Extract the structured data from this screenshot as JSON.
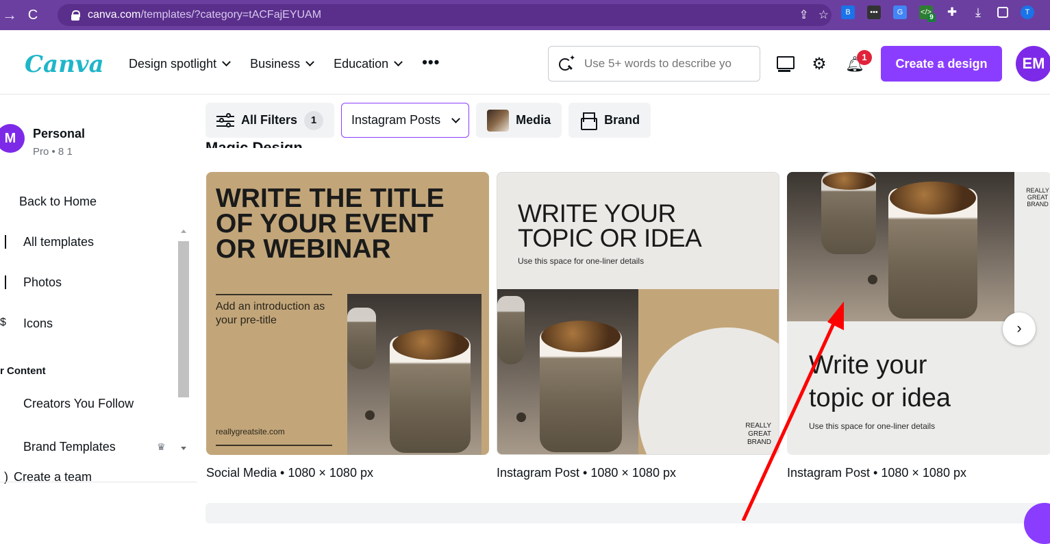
{
  "browser": {
    "url_host": "canva.com",
    "url_path": "/templates/?category=tACFajEYUAM",
    "ext_badge": "9",
    "profile_initial": "T"
  },
  "header": {
    "logo": "Canva",
    "nav": [
      "Design spotlight",
      "Business",
      "Education"
    ],
    "more": "•••",
    "search_placeholder": "Use 5+ words to describe yo",
    "notification_count": "1",
    "create_button": "Create a design",
    "avatar": "EM"
  },
  "sidebar": {
    "account_initial": "M",
    "account_name": "Personal",
    "account_sub": "Pro • 8 1",
    "back_home": "Back to Home",
    "items": [
      "All templates",
      "Photos",
      "Icons"
    ],
    "section": "r Content",
    "section_items": [
      "Creators You Follow",
      "Brand Templates"
    ],
    "create_team": "Create a team"
  },
  "filters": {
    "all_filters": "All Filters",
    "all_filters_count": "1",
    "category": "Instagram Posts",
    "media": "Media",
    "brand": "Brand"
  },
  "section_title": "Magic Design",
  "cards": [
    {
      "title": "WRITE THE TITLE OF YOUR EVENT OR WEBINAR",
      "subtitle": "Add an introduction as your pre-title",
      "site": "reallygreatsite.com",
      "caption": "Social Media • 1080 × 1080 px"
    },
    {
      "title": "WRITE YOUR TOPIC OR IDEA",
      "subtitle": "Use this space for one-liner details",
      "brand": "REALLY GREAT BRAND",
      "caption": "Instagram Post • 1080 × 1080 px"
    },
    {
      "title": "Write your topic or idea",
      "subtitle": "Use this space for one-liner details",
      "brand": "REALLY GREAT BRAND",
      "caption": "Instagram Post • 1080 × 1080 px"
    }
  ],
  "colors": {
    "chrome": "#6b3fa0",
    "brand_purple": "#8b3dff",
    "logo_teal": "#1fb6c9",
    "card_tan": "#c2a67a",
    "annotation_arrow": "#ff0000"
  }
}
